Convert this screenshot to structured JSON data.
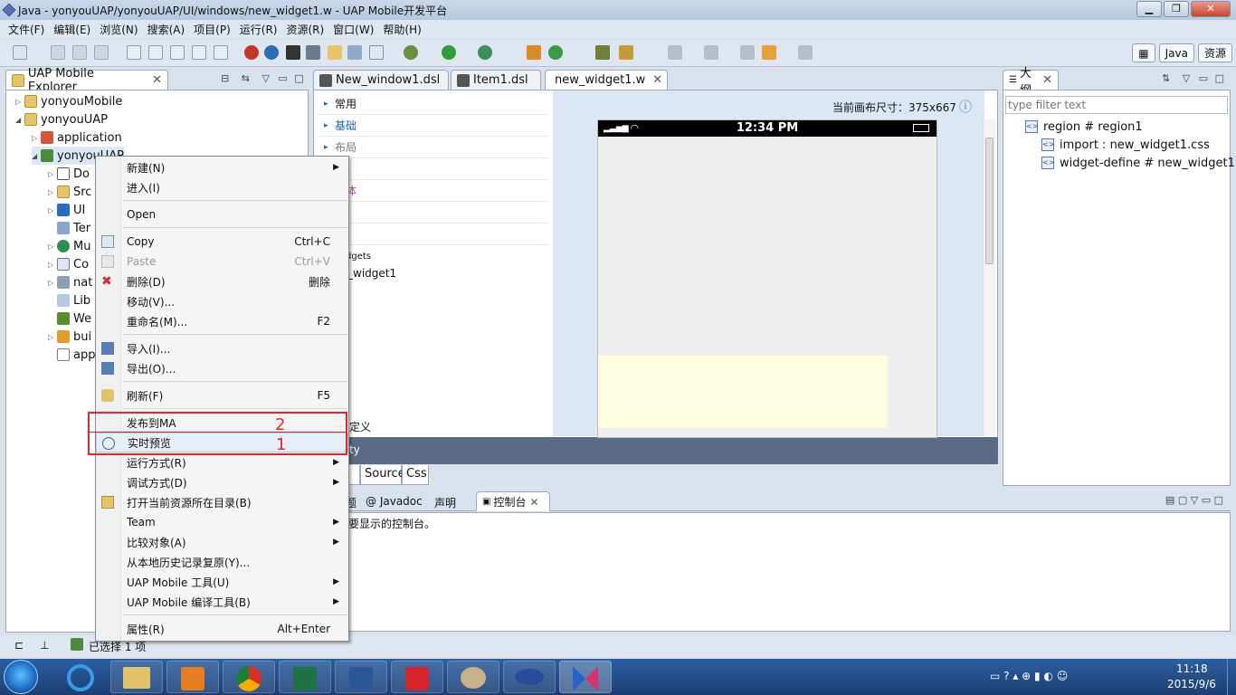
{
  "window": {
    "title": "Java  -  yonyouUAP/yonyouUAP/UI/windows/new_widget1.w  -  UAP Mobile开发平台",
    "min": "▁",
    "max": "❐",
    "close": "✕"
  },
  "menubar": [
    "文件(F)",
    "编辑(E)",
    "浏览(N)",
    "搜索(A)",
    "项目(P)",
    "运行(R)",
    "资源(R)",
    "窗口(W)",
    "帮助(H)"
  ],
  "perspectives": {
    "java": "Java",
    "resource": "资源"
  },
  "explorer": {
    "title": "UAP Mobile Explorer",
    "items": [
      {
        "label": "yonyouMobile",
        "level": 0
      },
      {
        "label": "yonyouUAP",
        "level": 0
      },
      {
        "label": "application",
        "level": 1
      },
      {
        "label": "yonyouUAP",
        "level": 1
      },
      {
        "label": "Do",
        "level": 2
      },
      {
        "label": "Src",
        "level": 2
      },
      {
        "label": "UI",
        "level": 2
      },
      {
        "label": "Ter",
        "level": 2
      },
      {
        "label": "Mu",
        "level": 2
      },
      {
        "label": "Co",
        "level": 2
      },
      {
        "label": "nat",
        "level": 2
      },
      {
        "label": "Lib",
        "level": 2
      },
      {
        "label": "We",
        "level": 2
      },
      {
        "label": "bui",
        "level": 2
      },
      {
        "label": "app",
        "level": 2
      }
    ]
  },
  "context_menu": [
    {
      "label": "新建(N)",
      "submenu": true
    },
    {
      "label": "进入(I)"
    },
    {
      "label": "Open"
    },
    {
      "label": "Copy",
      "shortcut": "Ctrl+C"
    },
    {
      "label": "Paste",
      "shortcut": "Ctrl+V",
      "disabled": true
    },
    {
      "label": "删除(D)",
      "shortcut": "删除"
    },
    {
      "label": "移动(V)..."
    },
    {
      "label": "重命名(M)...",
      "shortcut": "F2"
    },
    {
      "label": "导入(I)..."
    },
    {
      "label": "导出(O)..."
    },
    {
      "label": "刷新(F)",
      "shortcut": "F5"
    },
    {
      "label": "发布到MA"
    },
    {
      "label": "实时预览"
    },
    {
      "label": "运行方式(R)",
      "submenu": true
    },
    {
      "label": "调试方式(D)",
      "submenu": true
    },
    {
      "label": "打开当前资源所在目录(B)"
    },
    {
      "label": "Team",
      "submenu": true
    },
    {
      "label": "比较对象(A)",
      "submenu": true
    },
    {
      "label": "从本地历史记录复原(Y)..."
    },
    {
      "label": "UAP Mobile 工具(U)",
      "submenu": true
    },
    {
      "label": "UAP Mobile 编译工具(B)",
      "submenu": true
    },
    {
      "label": "属性(R)",
      "shortcut": "Alt+Enter"
    }
  ],
  "annotations": {
    "n2": "2",
    "n1": "1"
  },
  "editor_tabs": [
    "New_window1.dsl",
    "Item1.dsl",
    "new_widget1.w"
  ],
  "palette": {
    "groups": [
      "常用",
      "基础",
      "布局",
      "台",
      "媒体",
      "级",
      "表"
    ],
    "widgets_header": "dgets",
    "widget_item": "_widget1",
    "custom": "定义",
    "bottom_label": "ty"
  },
  "canvas": {
    "size_label": "当前画布尺寸：375x667",
    "info_glyph": "ⓘ",
    "phone_time": "12:34 PM"
  },
  "editor_bottom_tabs": [
    "n",
    "Source",
    "Css"
  ],
  "outline": {
    "title": "大纲",
    "filter_placeholder": "type filter text",
    "items": [
      {
        "label": "region # region1",
        "level": 0
      },
      {
        "label": "import : new_widget1.css",
        "level": 1
      },
      {
        "label": "widget-define # new_widget1",
        "level": 1
      }
    ]
  },
  "console": {
    "tabs": [
      "题",
      "Javadoc",
      "声明",
      "控制台"
    ],
    "message": "有要显示的控制台。"
  },
  "status": {
    "selected": "已选择 1 项"
  },
  "taskbar": {
    "time": "11:18",
    "date": "2015/9/6"
  }
}
